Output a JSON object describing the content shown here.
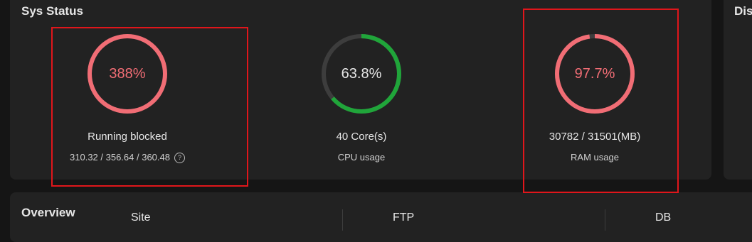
{
  "sys_status": {
    "title": "Sys Status",
    "gauges": [
      {
        "name": "load",
        "value_text": "388%",
        "fill_fraction": 1.0,
        "color": "#f16d75",
        "label": "Running blocked",
        "sub": "310.32 / 356.64 / 360.48",
        "help_icon": "question-circle-icon"
      },
      {
        "name": "cpu",
        "value_text": "63.8%",
        "fill_fraction": 0.638,
        "color": "#20a53a",
        "label": "40 Core(s)",
        "sub": "CPU usage"
      },
      {
        "name": "ram",
        "value_text": "97.7%",
        "fill_fraction": 0.977,
        "color": "#f16d75",
        "label": "30782 / 31501(MB)",
        "sub": "RAM usage"
      }
    ]
  },
  "disk": {
    "title": "Dis"
  },
  "overview": {
    "title": "Overview",
    "columns": [
      "Site",
      "FTP",
      "DB"
    ]
  },
  "colors": {
    "track": "#3d3d3d",
    "highlight": "#e0161b",
    "danger": "#f16d75",
    "ok": "#20a53a"
  }
}
